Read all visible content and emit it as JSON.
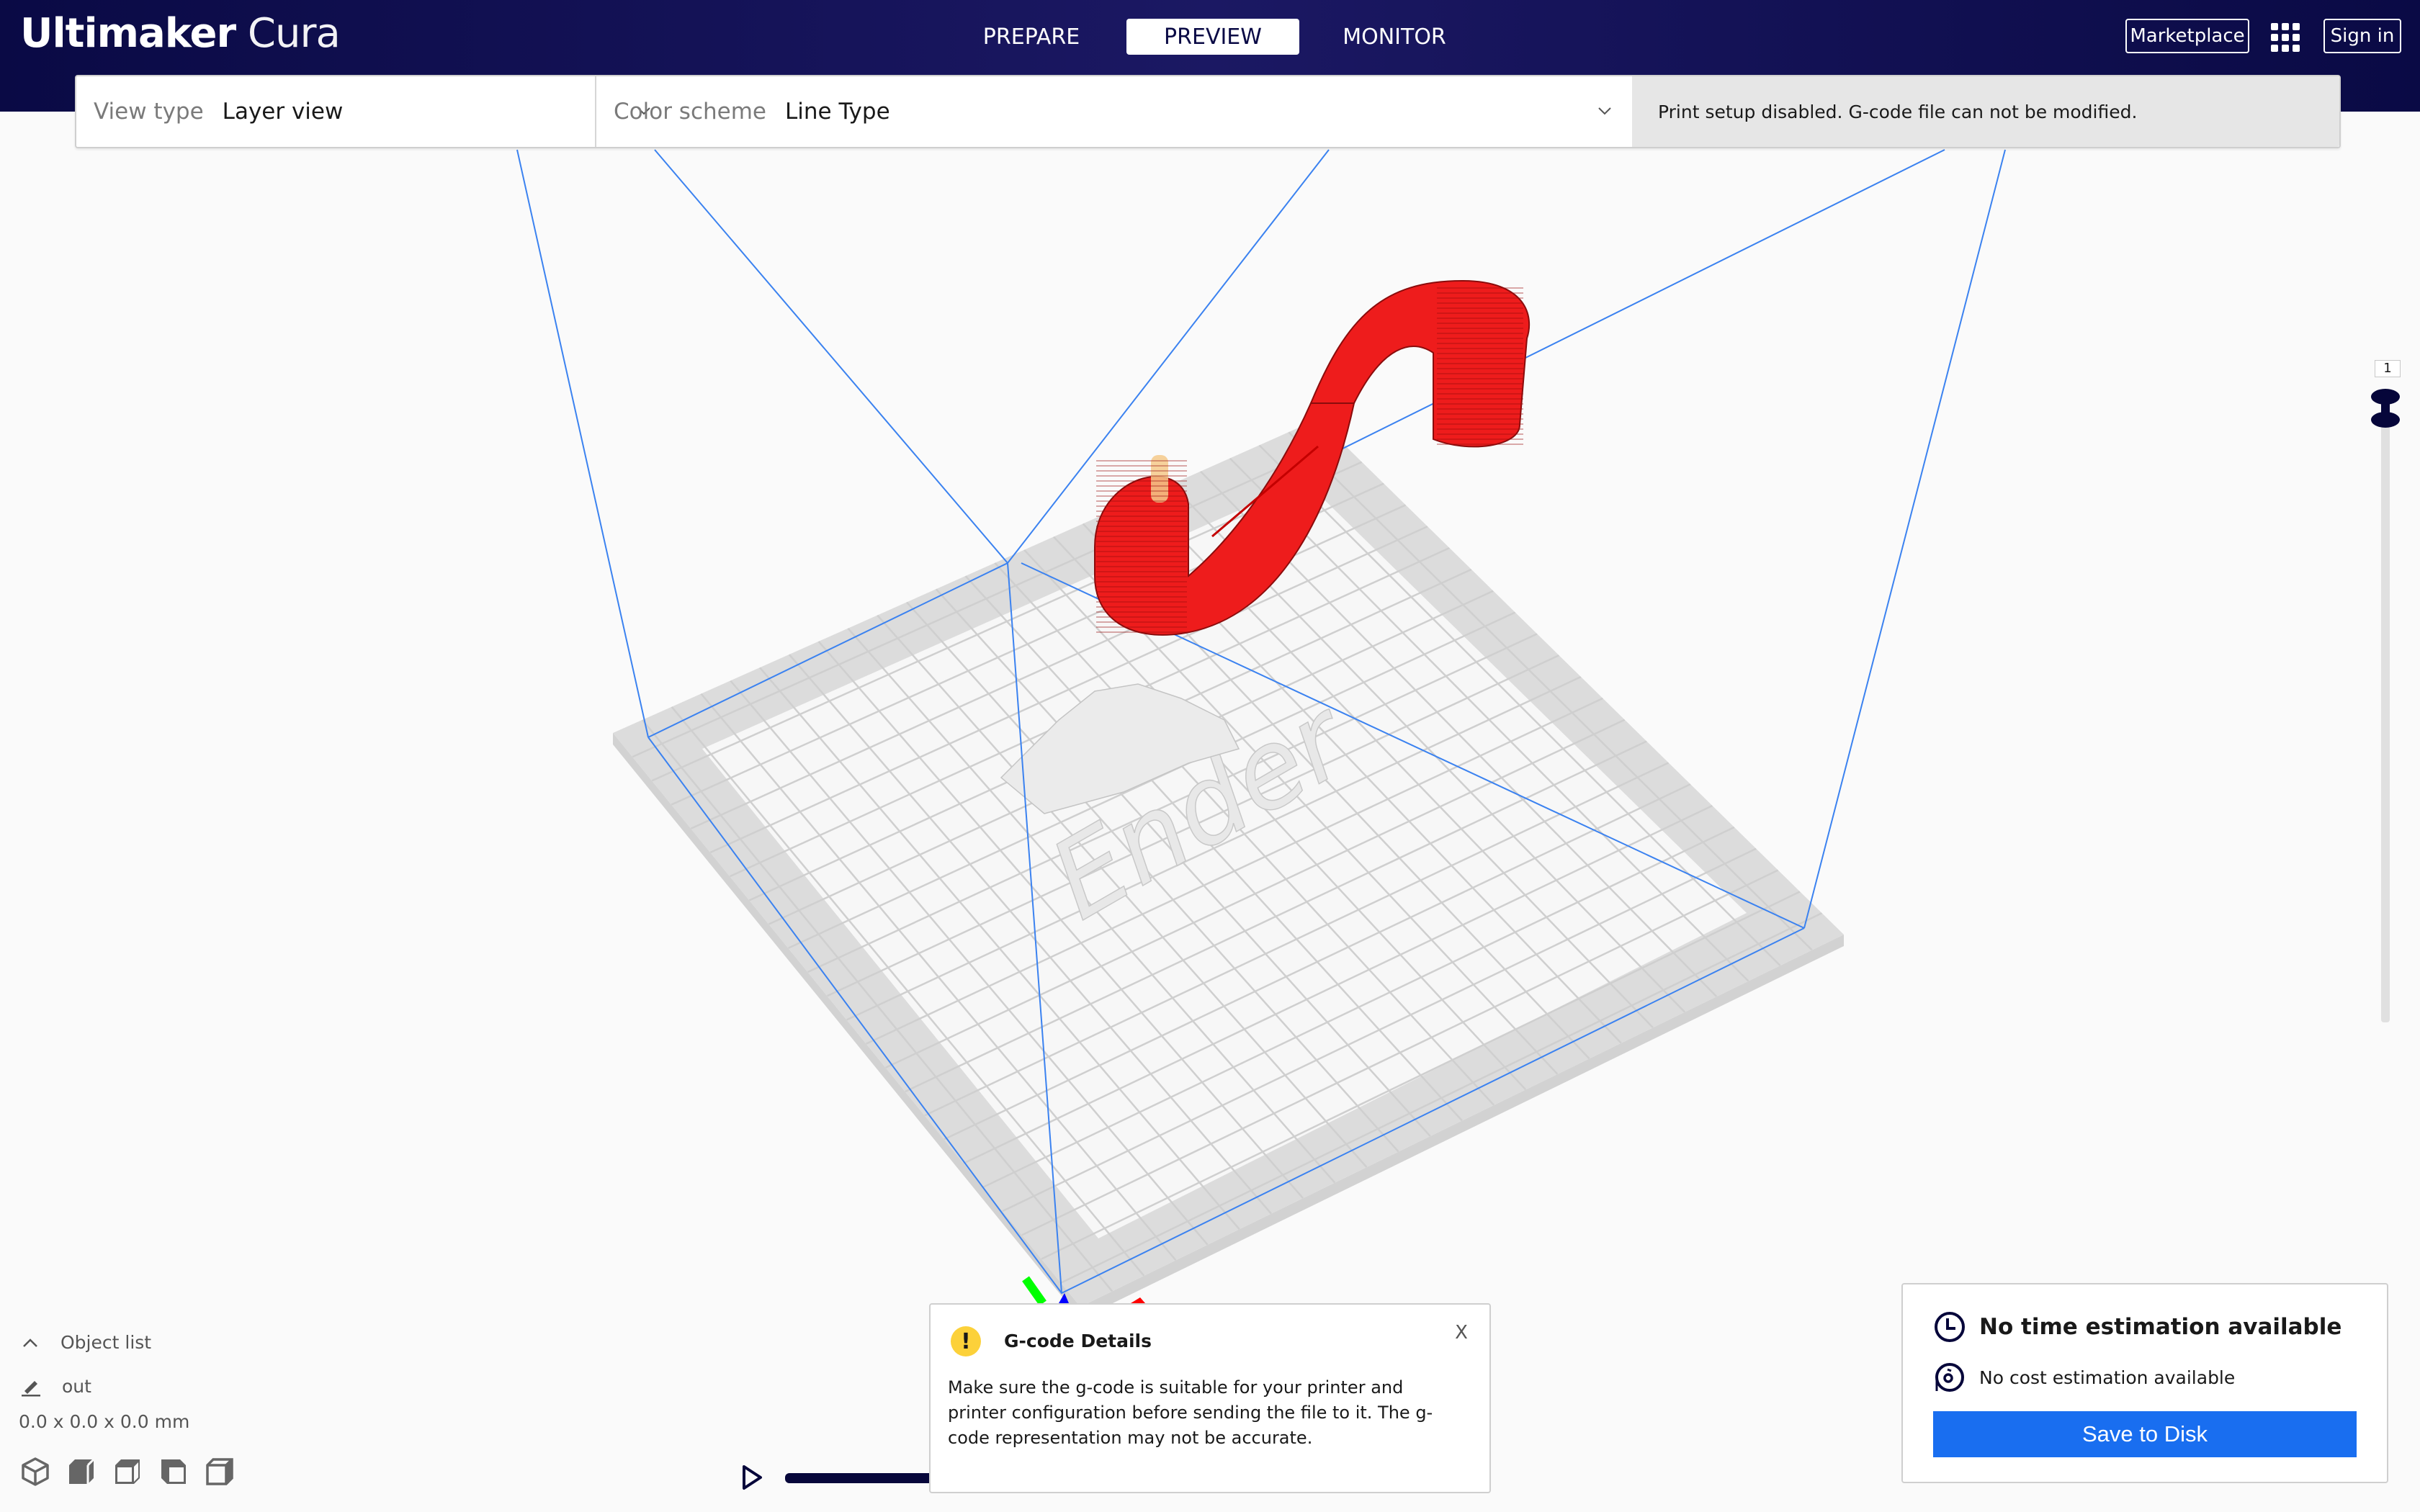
{
  "app": {
    "brand": "Ultimaker",
    "product": " Cura"
  },
  "stages": [
    {
      "label": "PREPARE",
      "active": false
    },
    {
      "label": "PREVIEW",
      "active": true
    },
    {
      "label": "MONITOR",
      "active": false
    }
  ],
  "header": {
    "marketplace_label": "Marketplace",
    "apps_icon": "grid-apps-icon",
    "signin_label": "Sign in"
  },
  "viewbar": {
    "view_type_label": "View type",
    "view_type_value": "Layer view",
    "color_scheme_label": "Color scheme",
    "color_scheme_value": "Line Type",
    "message": "Print setup disabled. G-code file can not be modified."
  },
  "layer_slider": {
    "current_layer": "1",
    "min_layer": 1,
    "max_layer": 1
  },
  "scene": {
    "model_color": "#ee1c1c",
    "volume_line_color": "#3b82f0",
    "bed_logo_text": "Ender",
    "axis_colors": {
      "x": "#ff0000",
      "y": "#00ff00",
      "z": "#0000ff"
    }
  },
  "object_list": {
    "toggle_label": "Object list",
    "object_name": "out",
    "dimensions": "0.0 x 0.0 x 0.0 mm",
    "view_buttons": [
      "3d-view",
      "front-view",
      "top-view",
      "left-view",
      "right-view"
    ]
  },
  "simulation": {
    "play_icon": "play-icon",
    "progress": 1.0
  },
  "gcode_popup": {
    "title": "G-code Details",
    "body": "Make sure the g-code is suitable for your printer and printer configuration before sending the file to it. The g-code representation may not be accurate.",
    "close_label": "X"
  },
  "print_info": {
    "time": "No time estimation available",
    "cost": "No cost estimation available",
    "save_label": "Save to Disk"
  },
  "colors": {
    "header_bg": "#0a0a45",
    "accent_blue": "#196ef0",
    "warning_yellow": "#fcd13a"
  }
}
